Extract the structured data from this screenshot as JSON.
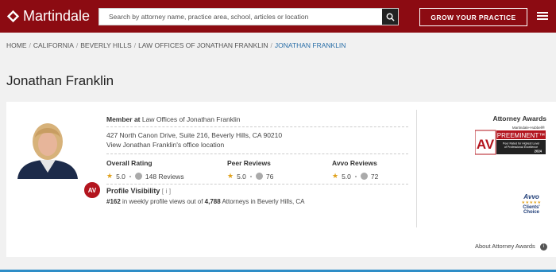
{
  "header": {
    "logo_text": "Martindale",
    "search_placeholder": "Search by attorney name, practice area, school, articles or location",
    "cta_label": "GROW YOUR PRACTICE",
    "brand_color": "#8c0b12"
  },
  "breadcrumb": [
    "HOME",
    "CALIFORNIA",
    "BEVERLY HILLS",
    "LAW OFFICES OF JONATHAN FRANKLIN",
    "JONATHAN FRANKLIN"
  ],
  "breadcrumb_separator": "/",
  "profile": {
    "name": "Jonathan Franklin",
    "av_badge": "AV",
    "member_at_label": "Member at",
    "firm": "Law Offices of Jonathan Franklin",
    "address": "427 North Canon Drive, Suite 216, Beverly Hills, CA 90210",
    "office_link": "View Jonathan Franklin's office location",
    "ratings": [
      {
        "title": "Overall Rating",
        "stars": "5.0",
        "reviews": "148 Reviews"
      },
      {
        "title": "Peer Reviews",
        "stars": "5.0",
        "reviews": "76"
      },
      {
        "title": "Avvo Reviews",
        "stars": "5.0",
        "reviews": "72"
      }
    ],
    "visibility_title": "Profile Visibility",
    "visibility_info": "[ i ]",
    "visibility_rank": "#162",
    "visibility_text_a": "in weekly profile views out of",
    "visibility_total": "4,788",
    "visibility_text_b": "Attorneys in Beverly Hills, CA"
  },
  "awards": {
    "title": "Attorney Awards",
    "preeminent_brand": "Martindale-Hubbell®",
    "preeminent_av": "AV",
    "preeminent_word": "PREEMINENT™",
    "preeminent_sub1": "Peer Rated for Highest Level",
    "preeminent_sub2": "of Professional Excellence",
    "preeminent_year": "2024",
    "avvo_word": "Avvo",
    "avvo_stars": "★★★★★",
    "avvo_clients_choice": "Clients' Choice",
    "about_link": "About Attorney Awards",
    "info_glyph": "i"
  }
}
